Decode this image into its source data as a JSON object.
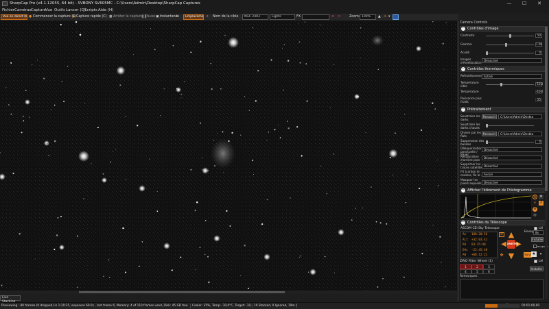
{
  "window": {
    "title": "SharpCap Pro (v4.1.12055, 64 bit) - SVBONY SV605MC - C:\\Users\\Admin\\Desktop\\SharpCap Captures",
    "min": "—",
    "max": "☐",
    "close": "✕"
  },
  "menu": [
    "Fichier",
    "Caméras",
    "Capture",
    "Vue",
    "Outils",
    "Lancer (Q)",
    "Scripts",
    "Aide (H)"
  ],
  "toolbar": {
    "live_stack": "Vue en direct (W)",
    "start_capture": "Commencer la capture (S)",
    "quick_capture": "Capture rapide (C)",
    "stop_capture": "Arrêter la capture",
    "pause": "Pause",
    "snapshot": "Instantané",
    "reticle": "Emplacement",
    "target_name_label": "Nom de la cible",
    "target_name_value": "NGC 2403",
    "frame_type": "Lights",
    "fx_label": "FX",
    "zoom_label": "Zoom:",
    "zoom_value": "100%",
    "accent": "#c86a1a"
  },
  "image_view": {
    "live_stacking_btn": "Live Stacking"
  },
  "status": {
    "previewing": "Previewing : 80 frames (0 dropped) in 1:20:25, exposure 60.0s , last frame 60.0s",
    "memory": "Memory: 4 of 110 frames used, Disk: 45 GB free",
    "cooler": "Cooler: 25%, Temp: -10,0°C, Target: -10,0°C",
    "stacked": "19 Stacked, 0 Ignored, 19m 0s",
    "frame_label": "Frame",
    "frame_progress": 0.35,
    "time": "00:01:00,00"
  },
  "panel": {
    "header": "Camera Controls",
    "image_controls": {
      "title": "Contrôles d'image",
      "rows": [
        {
          "label": "Contraste",
          "value": "50",
          "pos": 0.5
        },
        {
          "label": "Gamma",
          "value": "1.00",
          "pos": 0.4
        },
        {
          "label": "Acuité",
          "value": "0",
          "pos": 0.0
        }
      ],
      "auto_label": "Images d'Amélioration",
      "auto_value": "Désactivé"
    },
    "thermal": {
      "title": "Contrôles thermiques",
      "cooler_label": "Refroidissement",
      "cooler_value": "Activé",
      "target_label": "Température cible",
      "target_value": "-10,0",
      "target_pos": 0.3,
      "temp_label": "Température",
      "temp_value": "-10,0",
      "power_label": "Puissance plus froids",
      "power_value": "25"
    },
    "preprocessing": {
      "title": "Prétraitement",
      "dark_label": "Soustraire les darks",
      "dark_btn": "Parcourir",
      "dark_path": "C:\\Users\\Admin\\Deskto",
      "dark_level_label": "Soustraire les darks chauds",
      "flat_label": "Diviser par les flats",
      "flat_btn": "Parcourir",
      "flat_path": "C:\\Users\\Admin\\Deskto",
      "banding_label": "Suppression des bandes",
      "banding_value": "0",
      "debayer_label": "Débayerisation ponctuelle / Bayer",
      "debayer_value": "Désactivé",
      "hotpix_label": "Restauration d'arrière-plan",
      "hotpix_value": "Désactivé",
      "sat_label": "Supprimer les traces satellites",
      "sat_value": "Désactivé",
      "mode_label": "FX (canton le couleur, fix le ...",
      "mode_value": "Aucun",
      "mask_label": "Masquer les pixels exposés",
      "mask_value": "Désactivé"
    },
    "histogram": {
      "title": "Afficher l'étirement de l'histogramme"
    },
    "telescope": {
      "title": "Contrôles du Télescope",
      "device": "ASCOM CEl Sky Telescope",
      "follow_label": "Lié",
      "az_label": "Az",
      "az": "180:20:56",
      "alt_label": "Alt",
      "alt": "+32:03:41",
      "ra_label": "RA",
      "ra": "03:35:48",
      "dec_label": "Déc",
      "dec": "-22:45:48",
      "ah_label": "AH",
      "ah": "+00:12:22",
      "rate_label": "Envoyer",
      "rate_value": "8x",
      "goto_btn": "Installer",
      "stop_btn": "ARRÊTER",
      "park_label": "en garer",
      "speed_btn": "Suivi"
    },
    "filterwheel": {
      "title": "ZWO Filter Wheel (1)",
      "slots": [
        "1",
        "2",
        "3",
        "4",
        "5",
        "6"
      ],
      "follow_label": "Lié",
      "install_btn": "Installer"
    },
    "notes_label": "Remarques"
  }
}
